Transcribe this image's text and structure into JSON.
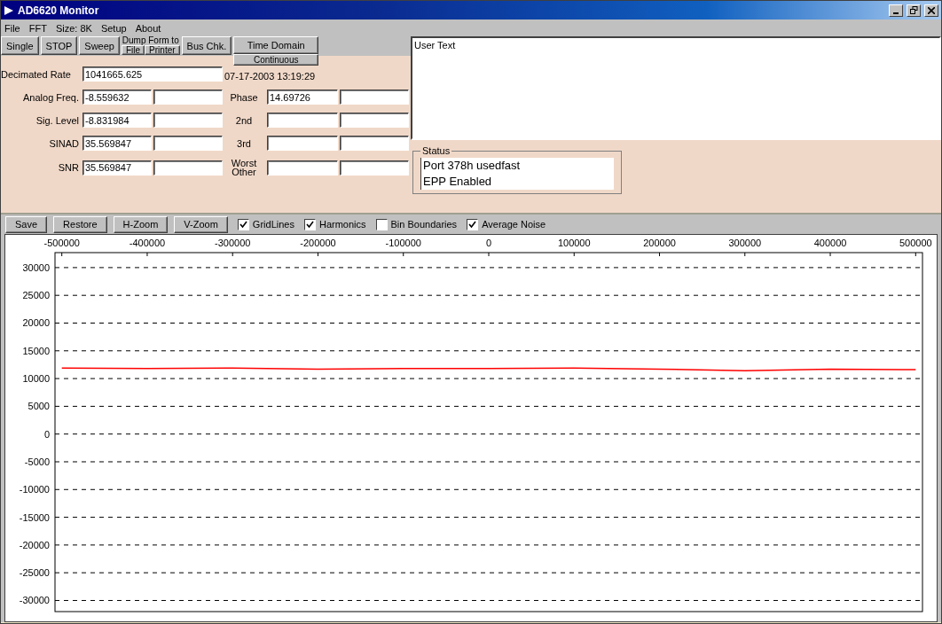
{
  "window": {
    "title": "AD6620 Monitor"
  },
  "menu": [
    "File",
    "FFT",
    "Size: 8K",
    "Setup",
    "About"
  ],
  "top_buttons": [
    {
      "kind": "button",
      "label": "Single"
    },
    {
      "kind": "button",
      "label": "STOP"
    },
    {
      "kind": "button",
      "label": "Sweep"
    },
    {
      "kind": "split",
      "label": "Dump Form to",
      "options": [
        "File",
        "Printer"
      ]
    },
    {
      "kind": "button",
      "label": "Bus Chk."
    },
    {
      "kind": "stack",
      "options": [
        "Time Domain",
        "Continuous"
      ]
    }
  ],
  "decimated_rate": {
    "label": "Decimated Rate",
    "value": "1041665.625"
  },
  "timestamp": "07-17-2003  13:19:29",
  "measurements": [
    {
      "label": "Analog Freq.",
      "value": "-8.559632",
      "label2": "Phase",
      "value2": "14.69726"
    },
    {
      "label": "Sig. Level",
      "value": "-8.831984",
      "label2": "2nd"
    },
    {
      "label": "SINAD",
      "value": "35.569847",
      "label2": "3rd"
    },
    {
      "label": "SNR",
      "value": "35.569847",
      "label2": "Worst Other"
    }
  ],
  "user_text": "User Text",
  "status": {
    "title": "Status",
    "lines": [
      "Port 378h usedfast",
      "EPP Enabled"
    ]
  },
  "plot_buttons": [
    "Save",
    "Restore",
    "H-Zoom",
    "V-Zoom"
  ],
  "options": [
    {
      "label": "GridLines",
      "checked": true
    },
    {
      "label": "Harmonics",
      "checked": true
    },
    {
      "label": "Bin Boundaries",
      "checked": false
    },
    {
      "label": "Average Noise",
      "checked": true
    }
  ],
  "chart_data": {
    "type": "line",
    "x": [
      -500000,
      -400000,
      -300000,
      -200000,
      -100000,
      0,
      100000,
      200000,
      300000,
      400000,
      500000
    ],
    "grid": true,
    "series": [
      {
        "color": "#ff0000",
        "values": [
          11900,
          11800,
          11900,
          11700,
          11800,
          11800,
          11900,
          11700,
          11400,
          11700,
          11600
        ]
      }
    ],
    "xlim": [
      -508000,
      508000
    ],
    "ylim": [
      -32000,
      32700
    ],
    "xticks": [
      -500000,
      -400000,
      -300000,
      -200000,
      -100000,
      0,
      100000,
      200000,
      300000,
      400000,
      500000
    ],
    "yticks": [
      -30000,
      -25000,
      -20000,
      -15000,
      -10000,
      -5000,
      0,
      5000,
      10000,
      15000,
      20000,
      25000,
      30000
    ]
  }
}
